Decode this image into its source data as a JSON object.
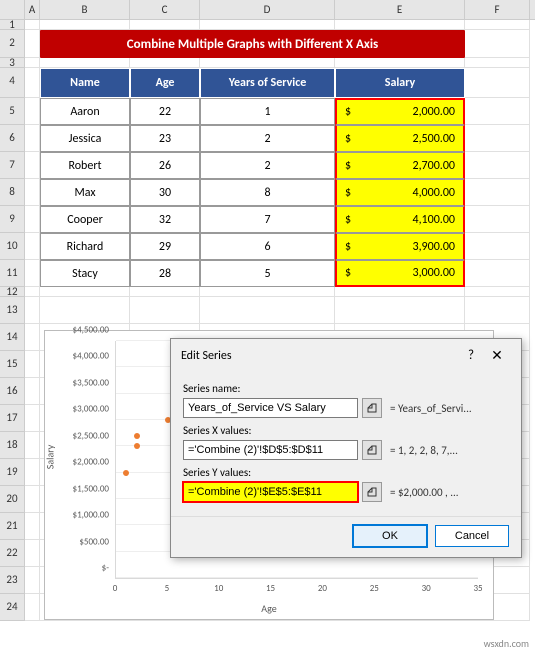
{
  "columns": [
    "A",
    "B",
    "C",
    "D",
    "E",
    "F"
  ],
  "row_labels": [
    "1",
    "2",
    "3",
    "4",
    "5",
    "6",
    "7",
    "8",
    "9",
    "10",
    "11",
    "12",
    "13",
    "14",
    "15",
    "16",
    "17",
    "18",
    "19",
    "20",
    "21",
    "22",
    "23",
    "24"
  ],
  "title": "Combine Multiple Graphs with Different X Axis",
  "table": {
    "headers": [
      "Name",
      "Age",
      "Years of Service",
      "Salary"
    ],
    "rows": [
      {
        "name": "Aaron",
        "age": "22",
        "years": "1",
        "salary": "2,000.00"
      },
      {
        "name": "Jessica",
        "age": "23",
        "years": "2",
        "salary": "2,500.00"
      },
      {
        "name": "Robert",
        "age": "26",
        "years": "2",
        "salary": "2,700.00"
      },
      {
        "name": "Max",
        "age": "30",
        "years": "8",
        "salary": "4,000.00"
      },
      {
        "name": "Cooper",
        "age": "32",
        "years": "7",
        "salary": "4,100.00"
      },
      {
        "name": "Richard",
        "age": "29",
        "years": "6",
        "salary": "3,900.00"
      },
      {
        "name": "Stacy",
        "age": "28",
        "years": "5",
        "salary": "3,000.00"
      }
    ],
    "currency": "$"
  },
  "chart_data": {
    "type": "scatter",
    "title": "",
    "xlabel": "Age",
    "ylabel": "Salary",
    "xlim": [
      0,
      35
    ],
    "ylim": [
      0,
      4500
    ],
    "x_ticks": [
      0,
      5,
      10,
      15,
      20,
      25,
      30,
      35
    ],
    "y_ticks": [
      "$-",
      "$500.00",
      "$1,000.00",
      "$1,500.00",
      "$2,000.00",
      "$2,500.00",
      "$3,000.00",
      "$3,500.00",
      "$4,000.00",
      "$4,500.00"
    ],
    "series": [
      {
        "name": "Years_of_Service VS Salary",
        "x": [
          1,
          2,
          2,
          8,
          7,
          6,
          5
        ],
        "y": [
          2000,
          2500,
          2700,
          4000,
          4100,
          3900,
          3000
        ]
      }
    ]
  },
  "dialog": {
    "title": "Edit Series",
    "labels": {
      "name": "Series name:",
      "x": "Series X values:",
      "y": "Series Y values:"
    },
    "values": {
      "name": "Years_of_Service VS Salary",
      "x": "='Combine (2)'!$D$5:$D$11",
      "y": "='Combine (2)'!$E$5:$E$11"
    },
    "previews": {
      "name": "= Years_of_Servi...",
      "x": "= 1, 2, 2, 8, 7,...",
      "y": "= $2,000.00 , ..."
    },
    "buttons": {
      "ok": "OK",
      "cancel": "Cancel"
    }
  },
  "watermark": "wsxdn.com"
}
